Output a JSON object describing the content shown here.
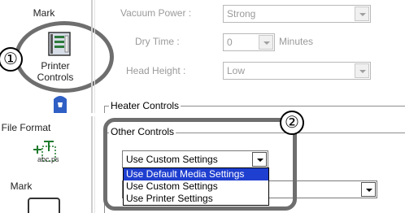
{
  "top_pane": {
    "sidebar": {
      "mark_label": "Mark",
      "printer_controls_label": "Printer Controls"
    },
    "settings": {
      "vacuum_power": {
        "label": "Vacuum Power :",
        "value": "Strong"
      },
      "dry_time": {
        "label": "Dry Time :",
        "value": "0",
        "unit": "Minutes"
      },
      "head_height": {
        "label": "Head Height :",
        "value": "Low"
      }
    },
    "heater_controls_title": "Heater Controls"
  },
  "bottom_pane": {
    "sidebar": {
      "file_format_label": "File Format",
      "file_format_icon_text": "abc.ps",
      "mark_label": "Mark"
    },
    "other_controls": {
      "title": "Other Controls",
      "selected_value": "Use Custom Settings",
      "options": [
        "Use Default Media Settings",
        "Use Custom Settings",
        "Use Printer Settings"
      ]
    }
  },
  "callouts": {
    "one": "①",
    "two": "②"
  },
  "colors": {
    "highlight": "#1f3fd0",
    "callout_ring": "#6e6e6e"
  }
}
